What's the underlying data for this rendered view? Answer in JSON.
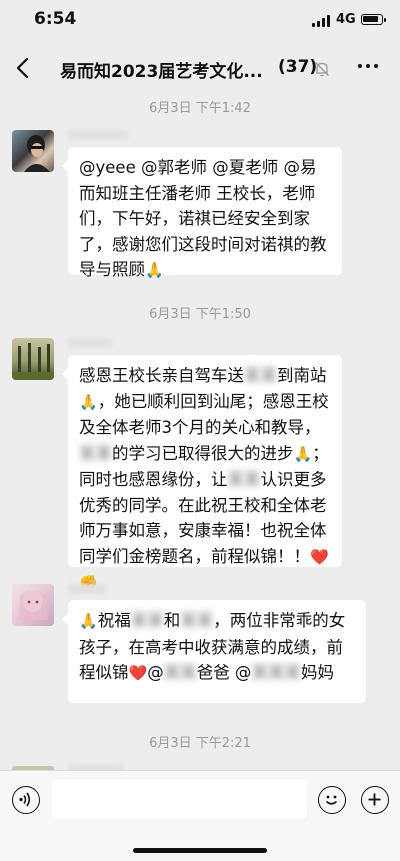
{
  "status_bar": {
    "time": "6:54",
    "network": "4G",
    "battery_level": 0.9
  },
  "header": {
    "title": "易而知2023届艺考文化...",
    "member_count": "(37)"
  },
  "messages": [
    {
      "timestamp": "6月3日 下午1:42",
      "parts": [
        {
          "t": "@yeee @郭老师 @夏老师 @易而知班主任潘老师 王校长，老师们，下午好，诺祺已经安全到家了，感谢您们这段时间对诺祺的教导与照顾"
        },
        {
          "e": "🙏"
        }
      ]
    },
    {
      "timestamp": "6月3日 下午1:50",
      "parts": [
        {
          "t": "感恩王校长亲自驾车送"
        },
        {
          "b": "某某"
        },
        {
          "t": "到南站"
        },
        {
          "e": "🙏"
        },
        {
          "t": "，她已顺利回到汕尾；感恩王校及全体老师3个月的关心和教导，"
        },
        {
          "b": "某某"
        },
        {
          "t": "的学习已取得很大的进步"
        },
        {
          "e": "🙏"
        },
        {
          "t": "；同时也感恩缘份，让"
        },
        {
          "b": "某某"
        },
        {
          "t": "认识更多优秀的同学。在此祝王校和全体老师万事如意，安康幸福！也祝全体同学们金榜题名，前程似锦！！"
        },
        {
          "e": "❤️"
        },
        {
          "e": "✊"
        }
      ]
    },
    {
      "parts": [
        {
          "e": "🙏"
        },
        {
          "t": "祝福"
        },
        {
          "b": "某某"
        },
        {
          "t": "和"
        },
        {
          "b": "某某"
        },
        {
          "t": "，两位非常乖的女孩子，在高考中收获满意的成绩，前程似锦"
        },
        {
          "e": "❤️"
        },
        {
          "t": "@"
        },
        {
          "b": "某某"
        },
        {
          "t": "爸爸 @"
        },
        {
          "b": "某某某"
        },
        {
          "t": "妈妈"
        }
      ]
    },
    {
      "timestamp": "6月3日 下午2:21"
    }
  ]
}
